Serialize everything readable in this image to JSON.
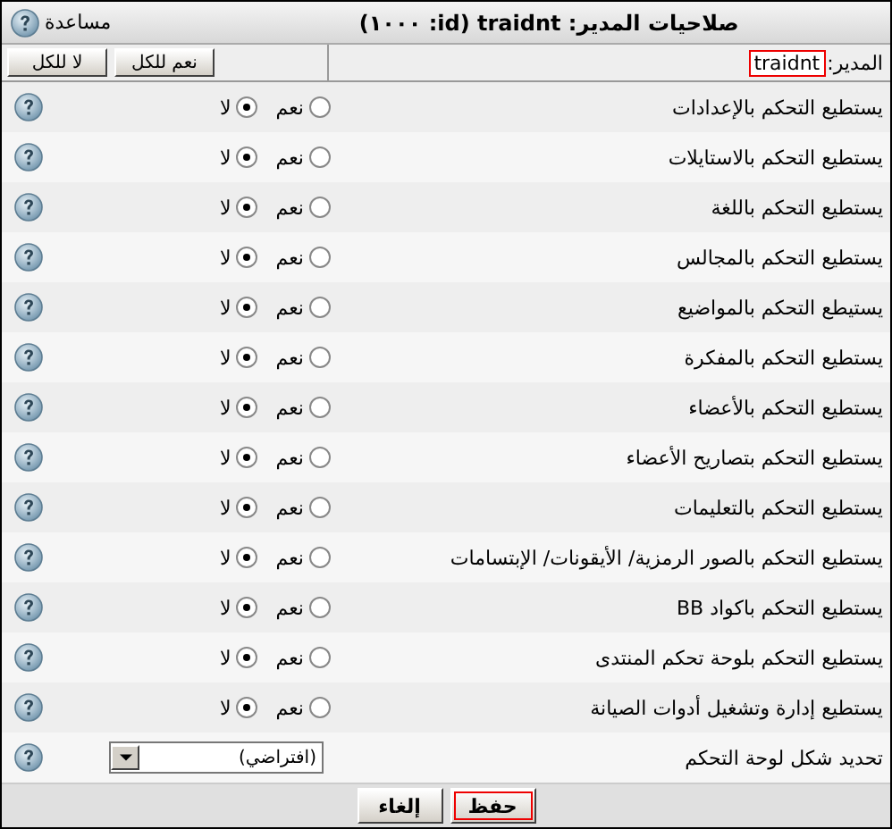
{
  "window": {
    "title": "صلاحيات المدير: traidnt (id: ١٠٠٠)",
    "help": "مساعدة"
  },
  "header": {
    "label": "المدير:",
    "name": "traidnt",
    "buttons": [
      "نعم للكل",
      "لا للكل"
    ]
  },
  "rows": [
    {
      "kind": "radio",
      "label": "يستطيع التحكم بالإعدادات",
      "options": [
        {
          "label": "نعم",
          "selected": false
        },
        {
          "label": "لا",
          "selected": true
        }
      ]
    },
    {
      "kind": "radio",
      "label": "يستطيع التحكم بالاستايلات",
      "options": [
        {
          "label": "نعم",
          "selected": false
        },
        {
          "label": "لا",
          "selected": true
        }
      ]
    },
    {
      "kind": "radio",
      "label": "يستطيع التحكم باللغة",
      "options": [
        {
          "label": "نعم",
          "selected": false
        },
        {
          "label": "لا",
          "selected": true
        }
      ]
    },
    {
      "kind": "radio",
      "label": "يستطيع التحكم بالمجالس",
      "options": [
        {
          "label": "نعم",
          "selected": false
        },
        {
          "label": "لا",
          "selected": true
        }
      ]
    },
    {
      "kind": "radio",
      "label": "يستيطع التحكم بالمواضيع",
      "options": [
        {
          "label": "نعم",
          "selected": false
        },
        {
          "label": "لا",
          "selected": true
        }
      ]
    },
    {
      "kind": "radio",
      "label": "يستطيع التحكم بالمفكرة",
      "options": [
        {
          "label": "نعم",
          "selected": false
        },
        {
          "label": "لا",
          "selected": true
        }
      ]
    },
    {
      "kind": "radio",
      "label": "يستطيع التحكم بالأعضاء",
      "options": [
        {
          "label": "نعم",
          "selected": false
        },
        {
          "label": "لا",
          "selected": true
        }
      ]
    },
    {
      "kind": "radio",
      "label": "يستطيع التحكم بتصاريح الأعضاء",
      "options": [
        {
          "label": "نعم",
          "selected": false
        },
        {
          "label": "لا",
          "selected": true
        }
      ]
    },
    {
      "kind": "radio",
      "label": "يستطيع التحكم بالتعليمات",
      "options": [
        {
          "label": "نعم",
          "selected": false
        },
        {
          "label": "لا",
          "selected": true
        }
      ]
    },
    {
      "kind": "radio",
      "label": "يستطيع التحكم بالصور الرمزية/ الأيقونات/ الإبتسامات",
      "options": [
        {
          "label": "نعم",
          "selected": false
        },
        {
          "label": "لا",
          "selected": true
        }
      ]
    },
    {
      "kind": "radio",
      "label": "يستطيع التحكم باكواد BB",
      "options": [
        {
          "label": "نعم",
          "selected": false
        },
        {
          "label": "لا",
          "selected": true
        }
      ]
    },
    {
      "kind": "radio",
      "label": "يستطيع التحكم بلوحة تحكم المنتدى",
      "options": [
        {
          "label": "نعم",
          "selected": false
        },
        {
          "label": "لا",
          "selected": true
        }
      ]
    },
    {
      "kind": "radio",
      "label": "يستطيع إدارة وتشغيل أدوات الصيانة",
      "options": [
        {
          "label": "نعم",
          "selected": false
        },
        {
          "label": "لا",
          "selected": true
        }
      ]
    },
    {
      "kind": "select",
      "label": "تحديد شكل لوحة التحكم",
      "value": "(افتراضي)"
    }
  ],
  "footer": {
    "buttons": [
      {
        "label": "حفظ",
        "focused": true
      },
      {
        "label": "إلغاء",
        "focused": false
      }
    ]
  }
}
